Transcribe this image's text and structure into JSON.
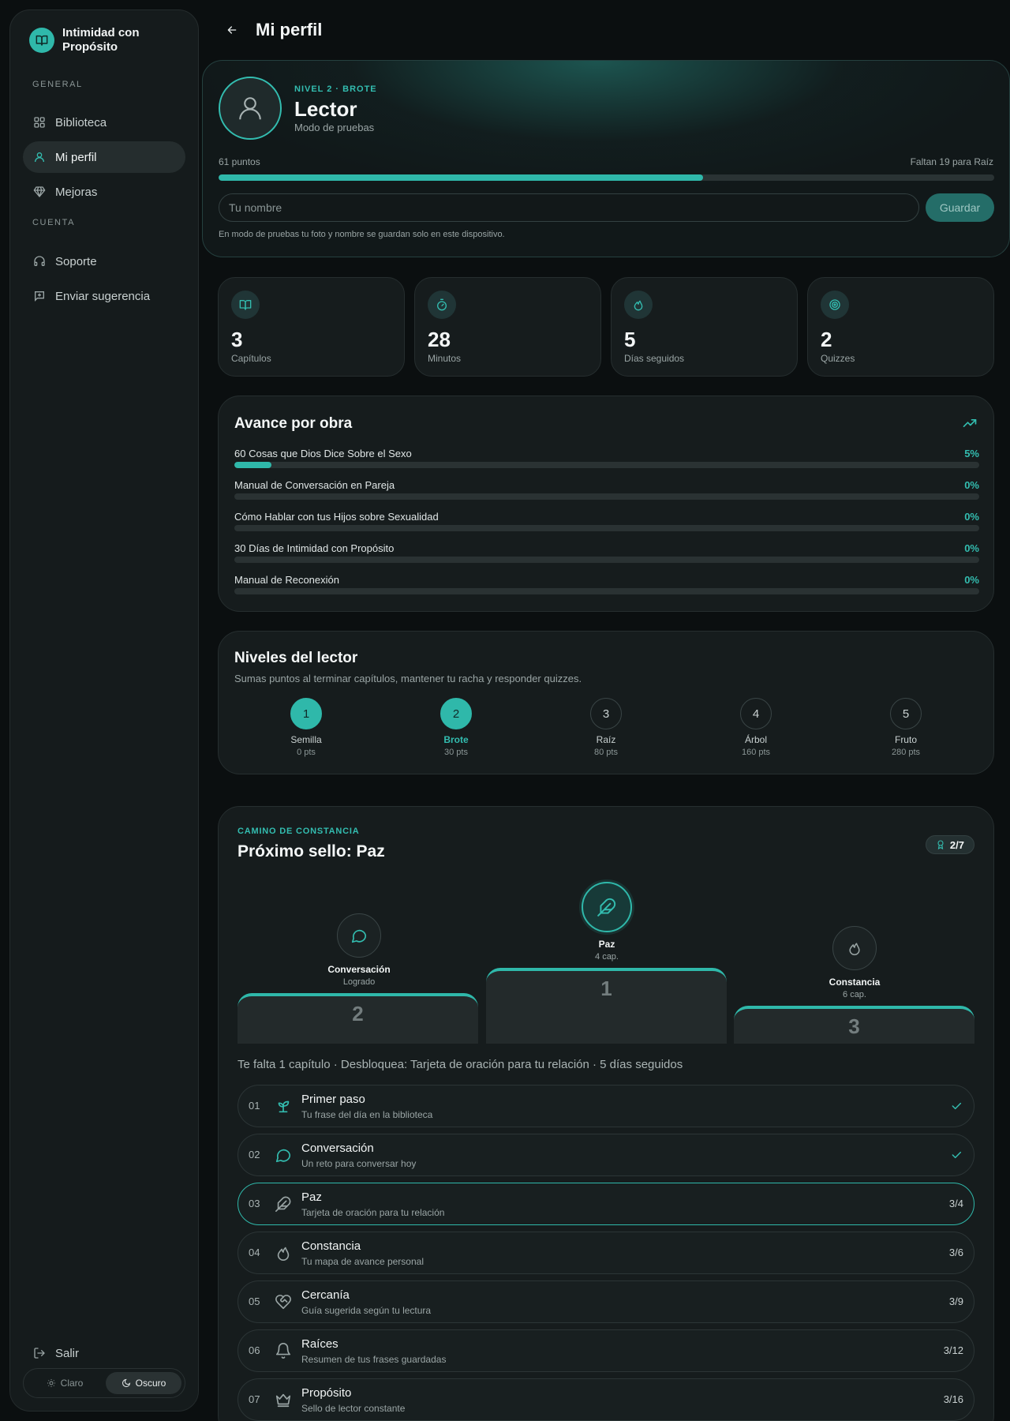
{
  "brand": {
    "name": "Intimidad con Propósito"
  },
  "sidebar": {
    "section_general": "GENERAL",
    "section_account": "CUENTA",
    "items": [
      {
        "label": "Biblioteca",
        "icon": "grid-icon",
        "active": false
      },
      {
        "label": "Mi perfil",
        "icon": "user-icon",
        "active": true
      },
      {
        "label": "Mejoras",
        "icon": "diamond-icon",
        "active": false
      },
      {
        "label": "Soporte",
        "icon": "headset-icon",
        "active": false
      },
      {
        "label": "Enviar sugerencia",
        "icon": "message-plus-icon",
        "active": false
      }
    ],
    "logout": "Salir",
    "theme": {
      "light": "Claro",
      "dark": "Oscuro",
      "selected": "dark"
    }
  },
  "header": {
    "title": "Mi perfil"
  },
  "profile": {
    "level_tag": "NIVEL 2 · BROTE",
    "name": "Lector",
    "subtitle": "Modo de pruebas",
    "points_label": "61 puntos",
    "points_remaining": "Faltan 19 para Raíz",
    "progress_fraction": 0.625,
    "name_placeholder": "Tu nombre",
    "save_label": "Guardar",
    "note": "En modo de pruebas tu foto y nombre se guardan solo en este dispositivo."
  },
  "stats": [
    {
      "value": "3",
      "label": "Capítulos",
      "icon": "book-icon"
    },
    {
      "value": "28",
      "label": "Minutos",
      "icon": "timer-icon"
    },
    {
      "value": "5",
      "label": "Días seguidos",
      "icon": "flame-icon"
    },
    {
      "value": "2",
      "label": "Quizzes",
      "icon": "target-icon"
    }
  ],
  "works": {
    "title": "Avance por obra",
    "items": [
      {
        "title": "60 Cosas que Dios Dice Sobre el Sexo",
        "pct_label": "5%",
        "pct": 5
      },
      {
        "title": "Manual de Conversación en Pareja",
        "pct_label": "0%",
        "pct": 0
      },
      {
        "title": "Cómo Hablar con tus Hijos sobre Sexualidad",
        "pct_label": "0%",
        "pct": 0
      },
      {
        "title": "30 Días de Intimidad con Propósito",
        "pct_label": "0%",
        "pct": 0
      },
      {
        "title": "Manual de Reconexión",
        "pct_label": "0%",
        "pct": 0
      }
    ]
  },
  "levels": {
    "title": "Niveles del lector",
    "subtitle": "Sumas puntos al terminar capítulos, mantener tu racha y responder quizzes.",
    "items": [
      {
        "num": "1",
        "name": "Semilla",
        "pts": "0 pts",
        "state": "done"
      },
      {
        "num": "2",
        "name": "Brote",
        "pts": "30 pts",
        "state": "current"
      },
      {
        "num": "3",
        "name": "Raíz",
        "pts": "80 pts",
        "state": "locked"
      },
      {
        "num": "4",
        "name": "Árbol",
        "pts": "160 pts",
        "state": "locked"
      },
      {
        "num": "5",
        "name": "Fruto",
        "pts": "280 pts",
        "state": "locked"
      }
    ]
  },
  "path": {
    "tag": "CAMINO DE CONSTANCIA",
    "title": "Próximo sello: Paz",
    "badge_count": "2/7",
    "podium": [
      {
        "rank": "2",
        "name": "Conversación",
        "sub": "Logrado",
        "icon": "chat-bubble-icon"
      },
      {
        "rank": "1",
        "name": "Paz",
        "sub": "4 cap.",
        "icon": "feather-icon"
      },
      {
        "rank": "3",
        "name": "Constancia",
        "sub": "6 cap.",
        "icon": "flame-icon"
      }
    ],
    "summary": "Te falta 1 capítulo · Desbloquea: Tarjeta de oración para tu relación · 5 días seguidos",
    "steps": [
      {
        "num": "01",
        "title": "Primer paso",
        "sub": "Tu frase del día en la biblioteca",
        "progress": "",
        "done": true,
        "icon": "sprout-icon"
      },
      {
        "num": "02",
        "title": "Conversación",
        "sub": "Un reto para conversar hoy",
        "progress": "",
        "done": true,
        "icon": "chat-bubble-icon"
      },
      {
        "num": "03",
        "title": "Paz",
        "sub": "Tarjeta de oración para tu relación",
        "progress": "3/4",
        "done": false,
        "icon": "feather-icon"
      },
      {
        "num": "04",
        "title": "Constancia",
        "sub": "Tu mapa de avance personal",
        "progress": "3/6",
        "done": false,
        "icon": "flame-icon"
      },
      {
        "num": "05",
        "title": "Cercanía",
        "sub": "Guía sugerida según tu lectura",
        "progress": "3/9",
        "done": false,
        "icon": "heart-handshake-icon"
      },
      {
        "num": "06",
        "title": "Raíces",
        "sub": "Resumen de tus frases guardadas",
        "progress": "3/12",
        "done": false,
        "icon": "bell-icon"
      },
      {
        "num": "07",
        "title": "Propósito",
        "sub": "Sello de lector constante",
        "progress": "3/16",
        "done": false,
        "icon": "crown-icon"
      }
    ]
  },
  "colors": {
    "accent": "#2fb8aa",
    "background": "#0b0f10",
    "card": "#161c1d"
  }
}
